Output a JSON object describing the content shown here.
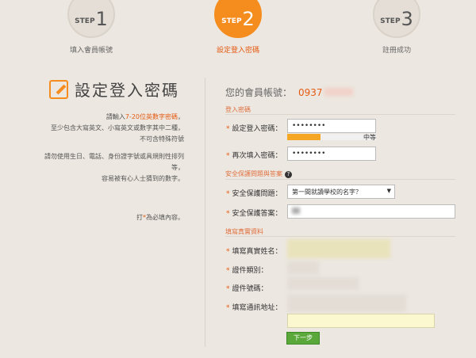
{
  "steps": [
    {
      "word": "STEP",
      "num": "1",
      "label": "填入會員帳號"
    },
    {
      "word": "STEP",
      "num": "2",
      "label": "設定登入密碼"
    },
    {
      "word": "STEP",
      "num": "3",
      "label": "註冊成功"
    }
  ],
  "left": {
    "title": "設定登入密碼",
    "note1_pre": "請輸入",
    "note1_hl": "7-20位英數字密碼",
    "note1_post": "，",
    "note1_l2": "至少包含大寫英文、小寫英文或數字其中二種，",
    "note1_l3": "不可含特殊符號",
    "note2_l1": "請勿使用生日、電話、身份證字號或具規則性排列",
    "note2_l2": "等，",
    "note2_l3": "容易被有心人士猜到的數字。",
    "required_pre": "打",
    "required_star": "*",
    "required_post": "為必填內容。"
  },
  "account": {
    "label": "您的會員帳號：",
    "value": "0937"
  },
  "sections": {
    "login": "登入密碼",
    "security": "安全保護問題與答案",
    "info": "填寫真實資料"
  },
  "fields": {
    "pwd_label": "設定登入密碼：",
    "pwd_value": "••••••••",
    "pwd2_label": "再次填入密碼：",
    "pwd2_value": "••••••••",
    "strength": "中等",
    "strength_level": 0.35,
    "q_label": "安全保護問題：",
    "q_value": "第一間就讀學校的名字？",
    "a_label": "安全保護答案：",
    "name_label": "填寫真實姓名：",
    "idtype_label": "證件類別：",
    "idno_label": "證件號碼：",
    "addr_label": "填寫通訊地址："
  },
  "star": "*",
  "help_icon": "?",
  "next": "下一步"
}
